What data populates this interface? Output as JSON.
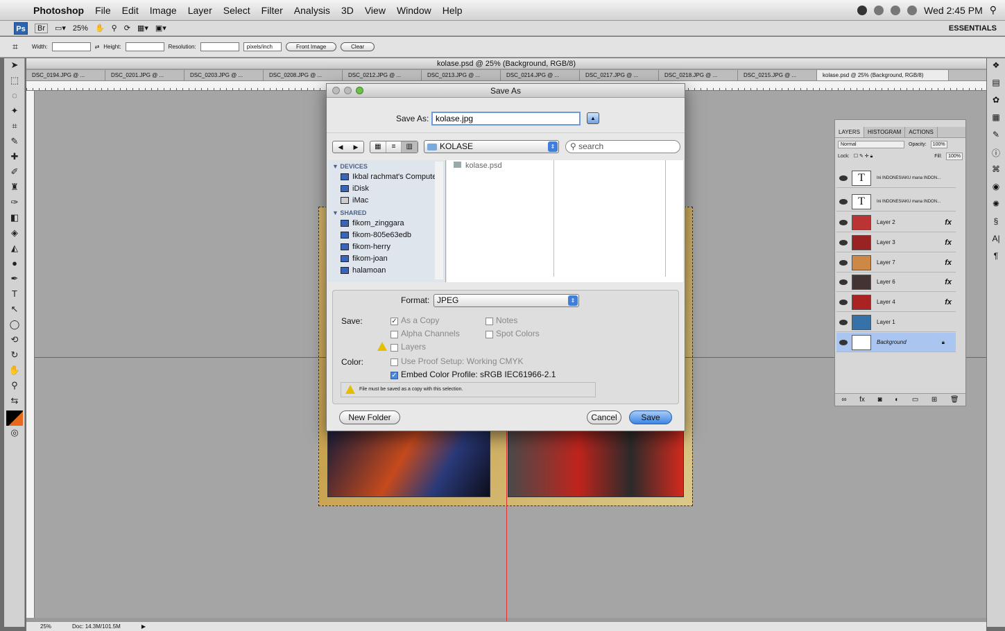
{
  "menubar": {
    "app": "Photoshop",
    "items": [
      "File",
      "Edit",
      "Image",
      "Layer",
      "Select",
      "Filter",
      "Analysis",
      "3D",
      "View",
      "Window",
      "Help"
    ],
    "clock": "Wed 2:45 PM"
  },
  "appbar": {
    "ps": "Ps",
    "br": "Br",
    "zoom": "25%",
    "workspace": "ESSENTIALS"
  },
  "options": {
    "width_label": "Width:",
    "height_label": "Height:",
    "resolution_label": "Resolution:",
    "units": "pixels/inch",
    "front_image": "Front Image",
    "clear": "Clear"
  },
  "document": {
    "title": "kolase.psd @ 25% (Background, RGB/8)",
    "tabs": [
      "DSC_0194.JPG @ ...",
      "DSC_0201.JPG @ ...",
      "DSC_0203.JPG @ ...",
      "DSC_0208.JPG @ ...",
      "DSC_0212.JPG @ ...",
      "DSC_0213.JPG @ ...",
      "DSC_0214.JPG @ ...",
      "DSC_0217.JPG @ ...",
      "DSC_0218.JPG @ ...",
      "DSC_0215.JPG @ ...",
      "kolase.psd @ 25% (Background, RGB/8)"
    ]
  },
  "status": {
    "zoom": "25%",
    "doc": "Doc: 14.3M/101.5M"
  },
  "dialog": {
    "title": "Save As",
    "saveas_label": "Save As:",
    "filename": "kolase.jpg",
    "folder": "KOLASE",
    "search_placeholder": "search",
    "devices_head": "DEVICES",
    "devices": [
      "Ikbal rachmat's Computer",
      "iDisk",
      "iMac"
    ],
    "shared_head": "SHARED",
    "shared": [
      "fikom_zinggara",
      "fikom-805e63edb",
      "fikom-herry",
      "fikom-joan",
      "halamoan"
    ],
    "file": "kolase.psd",
    "format_label": "Format:",
    "format": "JPEG",
    "save_label": "Save:",
    "as_copy": "As a Copy",
    "notes": "Notes",
    "alpha": "Alpha Channels",
    "spot": "Spot Colors",
    "layers": "Layers",
    "color_label": "Color:",
    "proof": "Use Proof Setup:  Working CMYK",
    "embed": "Embed Color Profile:  sRGB IEC61966-2.1",
    "warning": "File must be saved as a copy with this selection.",
    "new_folder": "New Folder",
    "cancel": "Cancel",
    "save": "Save"
  },
  "layers_panel": {
    "tabs": [
      "LAYERS",
      "HISTOGRAM",
      "ACTIONS"
    ],
    "blend": "Normal",
    "opacity_label": "Opacity:",
    "opacity": "100%",
    "lock_label": "Lock:",
    "fill_label": "Fill:",
    "fill": "100%",
    "layers": [
      "Ini INDONESIAKU mana INDON...",
      "Ini INDONESIAKU mana INDON...",
      "Layer 2",
      "Layer 3",
      "Layer 7",
      "Layer 6",
      "Layer 4",
      "Layer 1",
      "Background"
    ]
  }
}
